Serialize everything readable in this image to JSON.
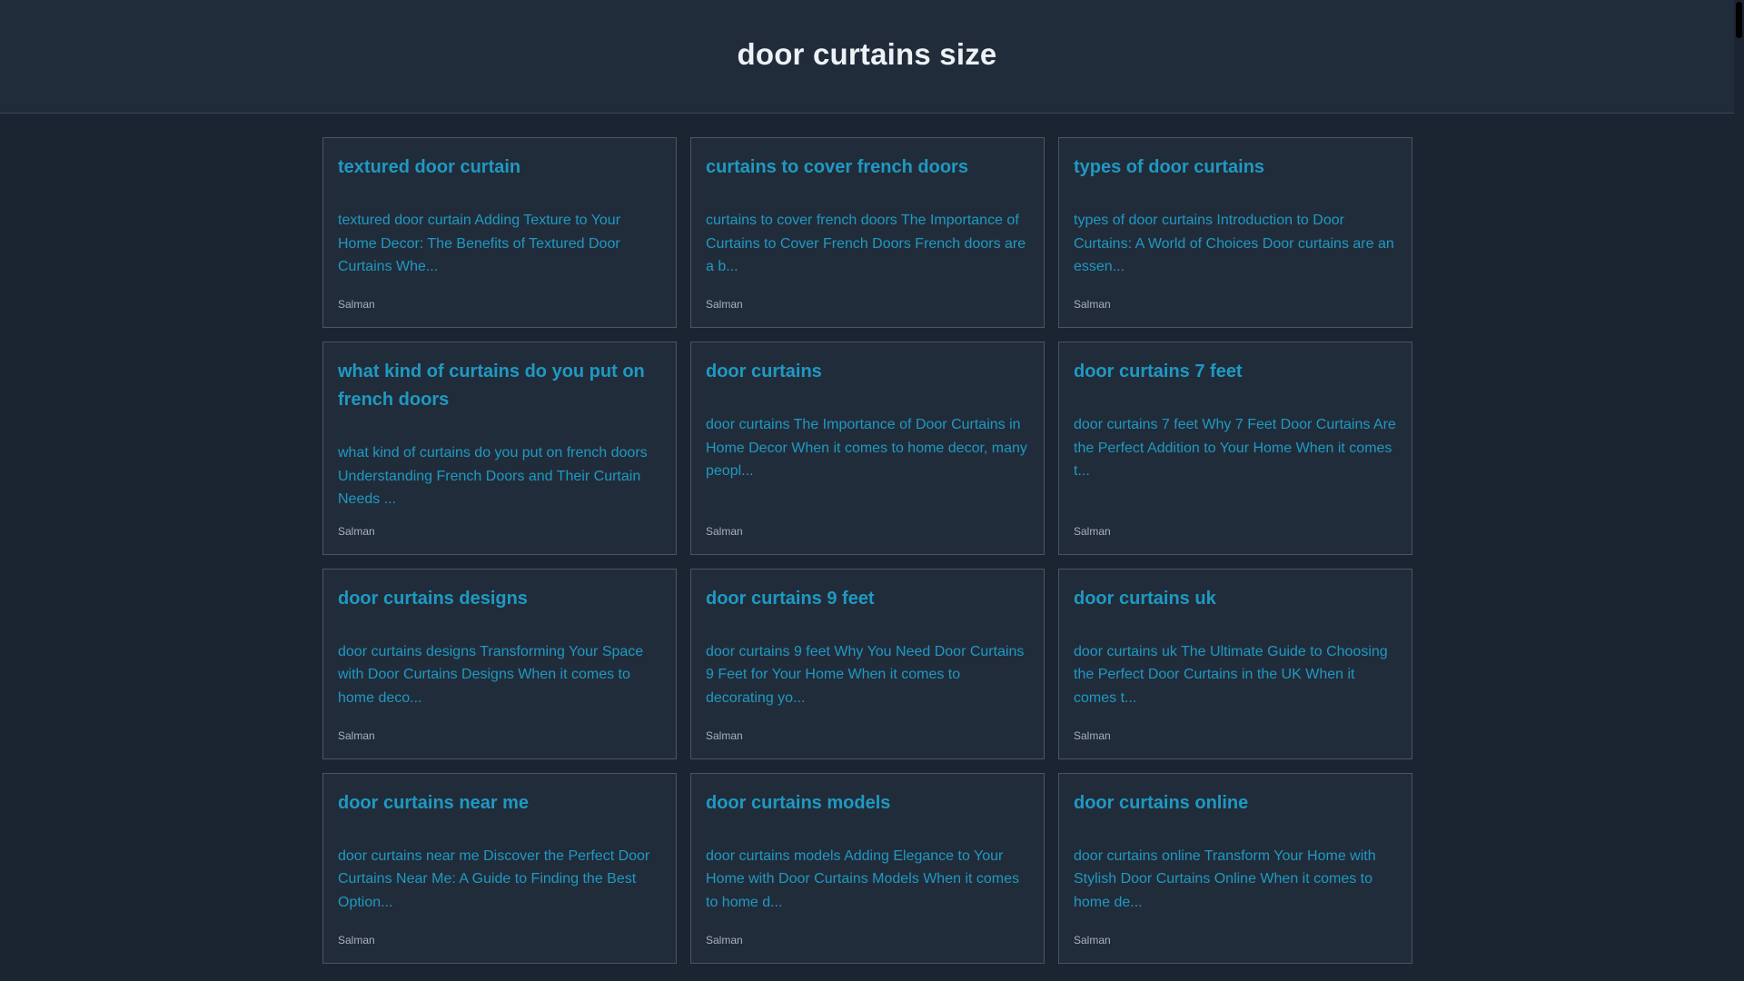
{
  "header": {
    "title": "door curtains size"
  },
  "posts": [
    {
      "title": "textured door curtain",
      "excerpt": "textured door curtain Adding Texture to Your Home Decor: The Benefits of Textured Door Curtains Whe...",
      "author": "Salman"
    },
    {
      "title": "curtains to cover french doors",
      "excerpt": "curtains to cover french doors The Importance of Curtains to Cover French Doors French doors are a b...",
      "author": "Salman"
    },
    {
      "title": "types of door curtains",
      "excerpt": "types of door curtains Introduction to Door Curtains: A World of Choices Door curtains are an essen...",
      "author": "Salman"
    },
    {
      "title": "what kind of curtains do you put on french doors",
      "excerpt": "what kind of curtains do you put on french doors Understanding French Doors and Their Curtain Needs ...",
      "author": "Salman"
    },
    {
      "title": "door curtains",
      "excerpt": "door curtains The Importance of Door Curtains in Home Decor When it comes to home decor, many peopl...",
      "author": "Salman"
    },
    {
      "title": "door curtains 7 feet",
      "excerpt": "door curtains 7 feet Why 7 Feet Door Curtains Are the Perfect Addition to Your Home When it comes t...",
      "author": "Salman"
    },
    {
      "title": "door curtains designs",
      "excerpt": "door curtains designs Transforming Your Space with Door Curtains Designs When it comes to home deco...",
      "author": "Salman"
    },
    {
      "title": "door curtains 9 feet",
      "excerpt": "door curtains 9 feet Why You Need Door Curtains 9 Feet for Your Home When it comes to decorating yo...",
      "author": "Salman"
    },
    {
      "title": "door curtains uk",
      "excerpt": "door curtains uk The Ultimate Guide to Choosing the Perfect Door Curtains in the UK When it comes t...",
      "author": "Salman"
    },
    {
      "title": "door curtains near me",
      "excerpt": "door curtains near me Discover the Perfect Door Curtains Near Me: A Guide to Finding the Best Option...",
      "author": "Salman"
    },
    {
      "title": "door curtains models",
      "excerpt": "door curtains models Adding Elegance to Your Home with Door Curtains Models When it comes to home d...",
      "author": "Salman"
    },
    {
      "title": "door curtains online",
      "excerpt": "door curtains online Transform Your Home with Stylish Door Curtains Online When it comes to home de...",
      "author": "Salman"
    }
  ],
  "colors": {
    "background": "#1b2431",
    "header_background": "#212c3a",
    "card_background": "#212c3a",
    "card_border": "#4a5563",
    "link": "#1f99c2",
    "title_text": "#eef2f6",
    "author_text": "#a7b1bc"
  }
}
